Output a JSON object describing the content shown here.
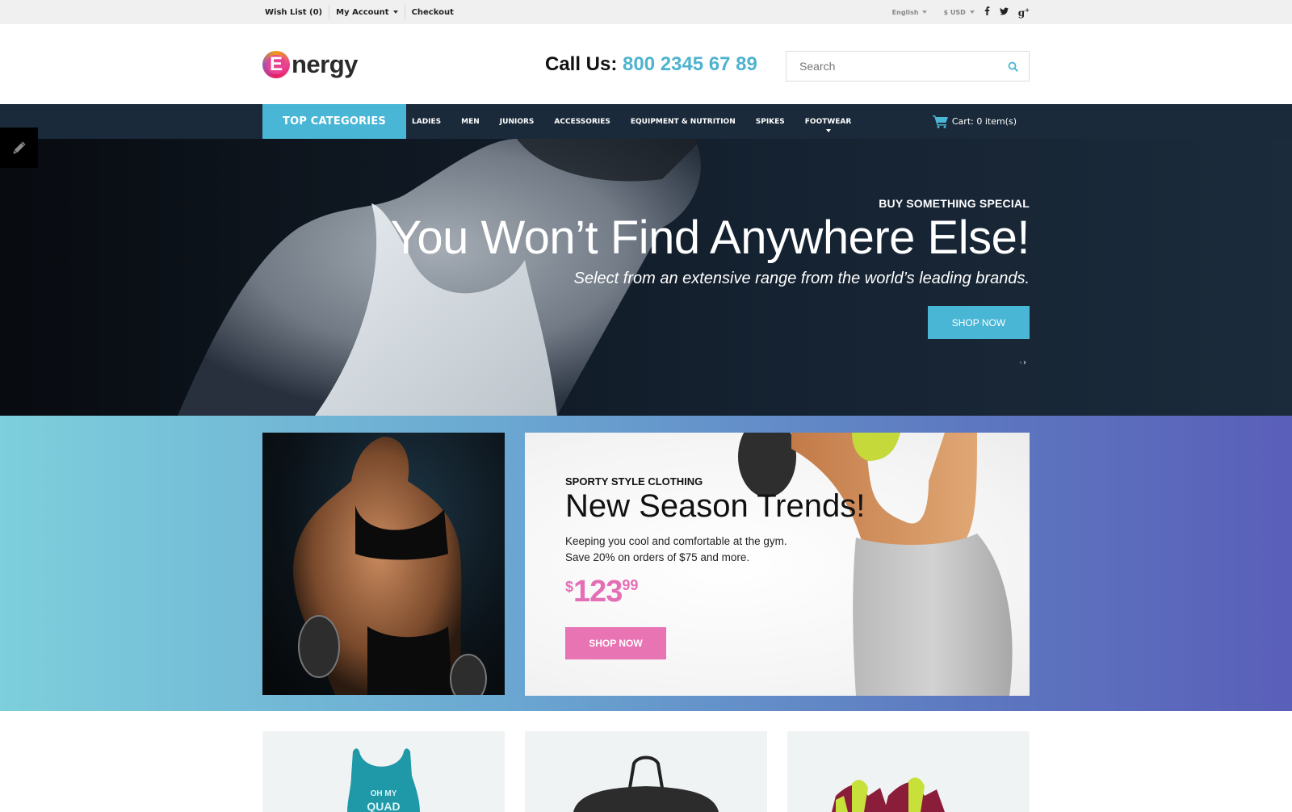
{
  "topbar": {
    "wishlist": "Wish List (0)",
    "my_account": "My Account",
    "checkout": "Checkout",
    "language": "English",
    "currency": "$ USD",
    "social": [
      {
        "name": "facebook-icon",
        "glyph": "f"
      },
      {
        "name": "twitter-icon",
        "glyph": "t"
      },
      {
        "name": "google-plus-icon",
        "glyph": "g+"
      }
    ]
  },
  "header": {
    "logo_letter": "E",
    "logo_text": "nergy",
    "call_label": "Call Us:",
    "phone": "800 2345 67 89",
    "search_placeholder": "Search"
  },
  "nav": {
    "top_categories": "TOP CATEGORIES",
    "items": [
      "LADIES",
      "MEN",
      "JUNIORS",
      "ACCESSORIES",
      "EQUIPMENT & NUTRITION",
      "SPIKES",
      "FOOTWEAR"
    ],
    "cart": "Cart: 0 item(s)"
  },
  "hero": {
    "kicker": "BUY SOMETHING SPECIAL",
    "title": "You Won’t Find Anywhere Else!",
    "subtitle": "Select from an extensive range from the world’s leading brands.",
    "button": "SHOP NOW",
    "prev": "‹",
    "next": "›"
  },
  "promo": {
    "kicker": "SPORTY STYLE CLOTHING",
    "title": "New Season Trends!",
    "desc_line1": "Keeping you cool and comfortable at the gym.",
    "desc_line2": "Save 20% on orders of $75 and more.",
    "price_currency": "$",
    "price_whole": "123",
    "price_cents": "99",
    "button": "SHOP NOW"
  },
  "colors": {
    "accent_blue": "#4ab6d5",
    "accent_pink": "#e874b4",
    "nav_bg": "#1a2a3a"
  },
  "products": [
    {
      "name": "tank-top-product"
    },
    {
      "name": "gym-bag-product"
    },
    {
      "name": "sneakers-product"
    }
  ]
}
